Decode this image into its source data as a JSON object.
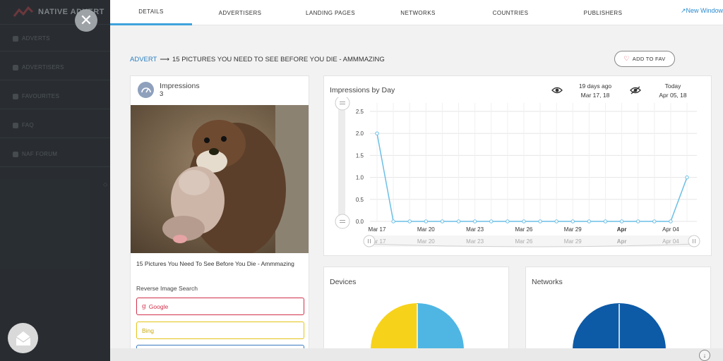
{
  "sidebar": {
    "logo_text": "NATIVE ADVERT",
    "items": [
      {
        "label": "ADVERTS"
      },
      {
        "label": "ADVERTISERS"
      },
      {
        "label": "FAVOURITES"
      },
      {
        "label": "FAQ"
      },
      {
        "label": "NAF FORUM"
      }
    ],
    "collapse_glyph": "◇"
  },
  "close_glyph": "✕",
  "tabs": [
    {
      "label": "DETAILS",
      "active": true
    },
    {
      "label": "ADVERTISERS"
    },
    {
      "label": "LANDING PAGES"
    },
    {
      "label": "NETWORKS"
    },
    {
      "label": "COUNTRIES"
    },
    {
      "label": "PUBLISHERS"
    }
  ],
  "new_window_label": "New Window",
  "breadcrumb": {
    "root": "ADVERT",
    "arrow": "⟶",
    "title": "15 PICTURES YOU NEED TO SEE BEFORE YOU DIE - AMMMAZING"
  },
  "fav_button_label": "ADD TO FAV",
  "impressions_card": {
    "label": "Impressions",
    "value": "3",
    "caption": "15 Pictures You Need To See Before You Die - Ammmazing",
    "reverse_search_label": "Reverse Image Search",
    "google_label": "Google",
    "bing_label": "Bing"
  },
  "chart_card": {
    "title": "Impressions by Day",
    "start_rel": "19 days ago",
    "start_date": "Mar 17, 18",
    "end_rel": "Today",
    "end_date": "Apr 05, 18"
  },
  "chart_data": {
    "type": "line",
    "x": [
      "Mar 17",
      "Mar 18",
      "Mar 19",
      "Mar 20",
      "Mar 21",
      "Mar 22",
      "Mar 23",
      "Mar 24",
      "Mar 25",
      "Mar 26",
      "Mar 27",
      "Mar 28",
      "Mar 29",
      "Mar 30",
      "Mar 31",
      "Apr 01",
      "Apr 02",
      "Apr 03",
      "Apr 04",
      "Apr 05"
    ],
    "series": [
      {
        "values": [
          2,
          0,
          0,
          0,
          0,
          0,
          0,
          0,
          0,
          0,
          0,
          0,
          0,
          0,
          0,
          0,
          0,
          0,
          0,
          1
        ]
      }
    ],
    "y_ticks": [
      "0.0",
      "0.5",
      "1.0",
      "1.5",
      "2.0",
      "2.5"
    ],
    "ylim": [
      0,
      2.5
    ],
    "x_tick_labels": [
      {
        "label": "Mar 17",
        "index": 0,
        "bold": false
      },
      {
        "label": "Mar 20",
        "index": 3,
        "bold": false
      },
      {
        "label": "Mar 23",
        "index": 6,
        "bold": false
      },
      {
        "label": "Mar 26",
        "index": 9,
        "bold": false
      },
      {
        "label": "Mar 29",
        "index": 12,
        "bold": false
      },
      {
        "label": "Apr",
        "index": 15,
        "bold": true
      },
      {
        "label": "Apr 04",
        "index": 18,
        "bold": false
      }
    ],
    "navigator_labels": [
      {
        "label": "Mar 17",
        "index": 0,
        "bold": false
      },
      {
        "label": "Mar 20",
        "index": 3,
        "bold": false
      },
      {
        "label": "Mar 23",
        "index": 6,
        "bold": false
      },
      {
        "label": "Mar 26",
        "index": 9,
        "bold": false
      },
      {
        "label": "Mar 29",
        "index": 12,
        "bold": false
      },
      {
        "label": "Apr",
        "index": 15,
        "bold": true
      },
      {
        "label": "Apr 04",
        "index": 18,
        "bold": false
      }
    ],
    "line_color": "#6bbfe6",
    "grid": true
  },
  "devices_card": {
    "title": "Devices",
    "colors": [
      "#f7d21a",
      "#4fb6e3"
    ]
  },
  "networks_card": {
    "title": "Networks",
    "colors": [
      "#0d5aa7",
      "#0d5aa7"
    ]
  },
  "scroll_down_glyph": "↓"
}
